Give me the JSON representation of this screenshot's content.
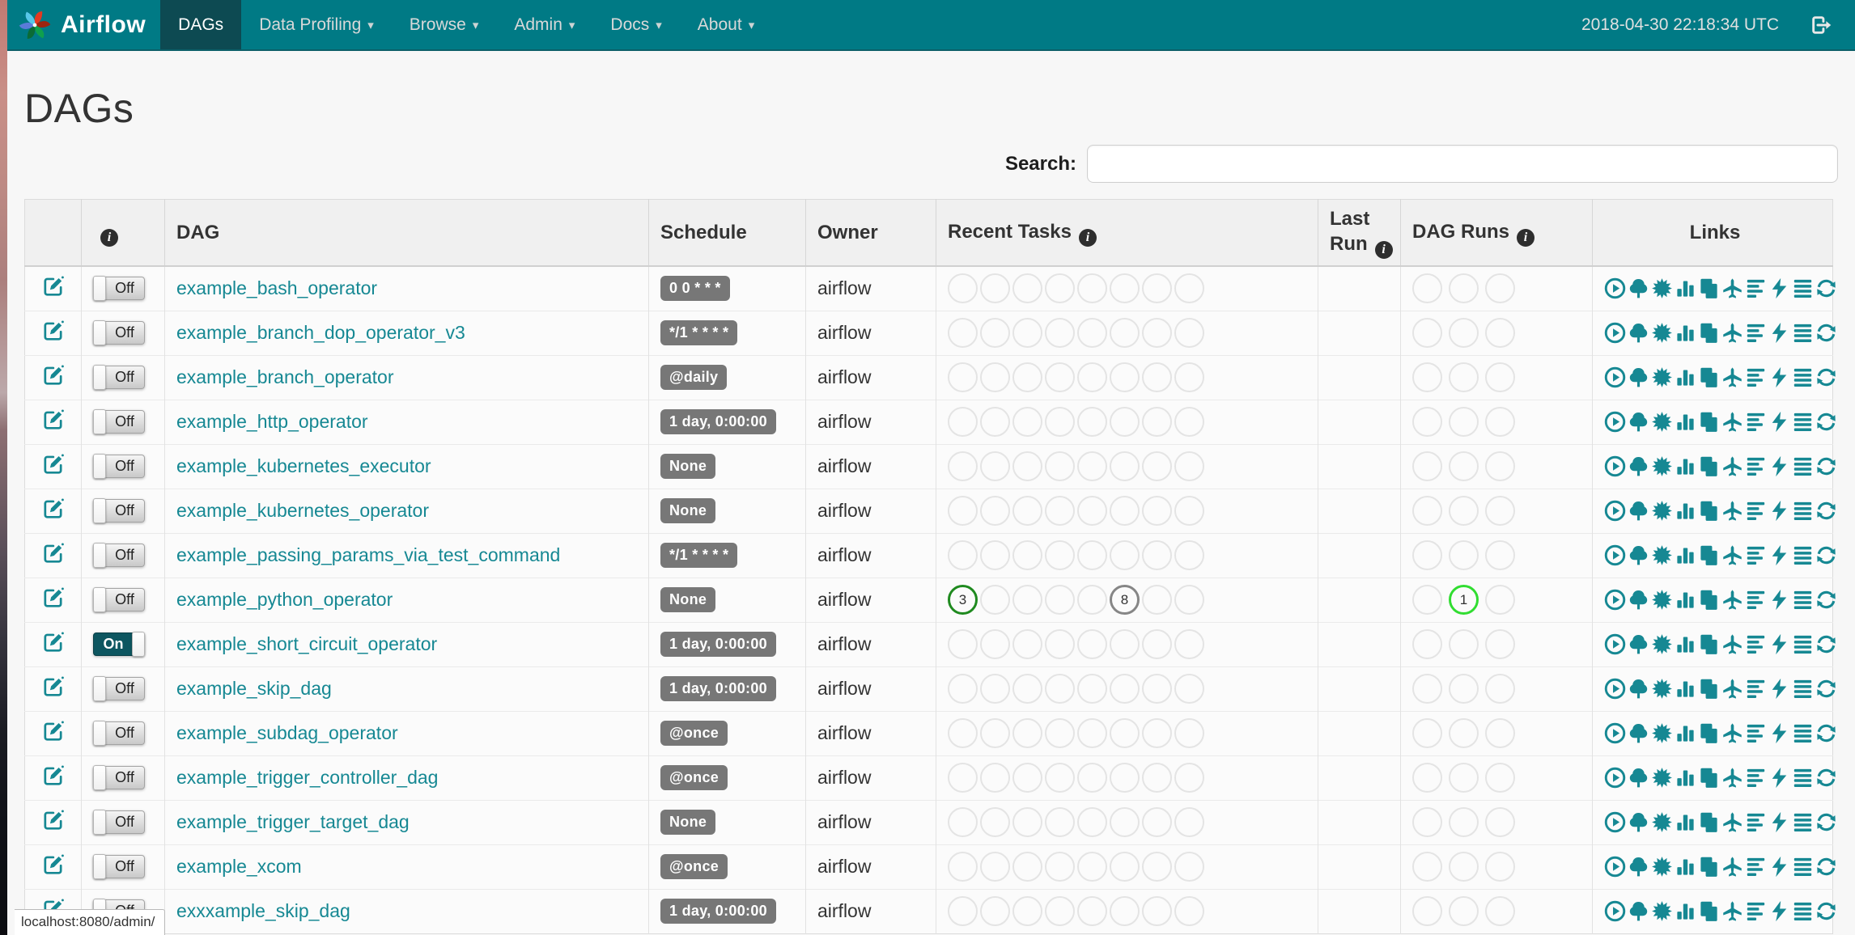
{
  "navbar": {
    "brand": "Airflow",
    "items": [
      {
        "label": "DAGs",
        "active": true,
        "caret": false
      },
      {
        "label": "Data Profiling",
        "active": false,
        "caret": true
      },
      {
        "label": "Browse",
        "active": false,
        "caret": true
      },
      {
        "label": "Admin",
        "active": false,
        "caret": true
      },
      {
        "label": "Docs",
        "active": false,
        "caret": true
      },
      {
        "label": "About",
        "active": false,
        "caret": true
      }
    ],
    "clock": "2018-04-30 22:18:34 UTC"
  },
  "page": {
    "title": "DAGs",
    "search_label": "Search:",
    "search_value": "",
    "status_tooltip": "localhost:8080/admin/"
  },
  "table": {
    "headers": [
      {
        "label": "",
        "info": false
      },
      {
        "label": "",
        "info": true
      },
      {
        "label": "DAG",
        "info": false
      },
      {
        "label": "Schedule",
        "info": false
      },
      {
        "label": "Owner",
        "info": false
      },
      {
        "label": "Recent Tasks",
        "info": true
      },
      {
        "label": "Last Run",
        "info": true
      },
      {
        "label": "DAG Runs",
        "info": true
      },
      {
        "label": "Links",
        "info": false,
        "center": true
      }
    ],
    "toggle_labels": {
      "on": "On",
      "off": "Off"
    },
    "recent_task_slots": 8,
    "dag_run_slots": 3,
    "state_colors": {
      "success": "#1f8a1f",
      "running": "#31dd31",
      "queued": "#868686",
      "empty": "#e4e4e4"
    },
    "links": [
      {
        "name": "trigger-dag",
        "icon": "play-circle"
      },
      {
        "name": "tree-view",
        "icon": "tree"
      },
      {
        "name": "graph-view",
        "icon": "certificate"
      },
      {
        "name": "task-duration",
        "icon": "bar-chart"
      },
      {
        "name": "task-tries",
        "icon": "duplicate"
      },
      {
        "name": "landing-times",
        "icon": "plane"
      },
      {
        "name": "gantt",
        "icon": "align-left"
      },
      {
        "name": "code-view",
        "icon": "flash"
      },
      {
        "name": "logs",
        "icon": "align-justify"
      },
      {
        "name": "refresh",
        "icon": "refresh"
      }
    ],
    "rows": [
      {
        "dag": "example_bash_operator",
        "enabled": false,
        "schedule": "0 0 * * *",
        "owner": "airflow",
        "last_run": "",
        "recent_tasks": {},
        "dag_runs": {}
      },
      {
        "dag": "example_branch_dop_operator_v3",
        "enabled": false,
        "schedule": "*/1 * * * *",
        "owner": "airflow",
        "last_run": "",
        "recent_tasks": {},
        "dag_runs": {}
      },
      {
        "dag": "example_branch_operator",
        "enabled": false,
        "schedule": "@daily",
        "owner": "airflow",
        "last_run": "",
        "recent_tasks": {},
        "dag_runs": {}
      },
      {
        "dag": "example_http_operator",
        "enabled": false,
        "schedule": "1 day, 0:00:00",
        "owner": "airflow",
        "last_run": "",
        "recent_tasks": {},
        "dag_runs": {}
      },
      {
        "dag": "example_kubernetes_executor",
        "enabled": false,
        "schedule": "None",
        "owner": "airflow",
        "last_run": "",
        "recent_tasks": {},
        "dag_runs": {}
      },
      {
        "dag": "example_kubernetes_operator",
        "enabled": false,
        "schedule": "None",
        "owner": "airflow",
        "last_run": "",
        "recent_tasks": {},
        "dag_runs": {}
      },
      {
        "dag": "example_passing_params_via_test_command",
        "enabled": false,
        "schedule": "*/1 * * * *",
        "owner": "airflow",
        "last_run": "",
        "recent_tasks": {},
        "dag_runs": {}
      },
      {
        "dag": "example_python_operator",
        "enabled": false,
        "schedule": "None",
        "owner": "airflow",
        "last_run": "",
        "recent_tasks": {
          "0": {
            "value": "3",
            "state": "success"
          },
          "5": {
            "value": "8",
            "state": "queued"
          }
        },
        "dag_runs": {
          "1": {
            "value": "1",
            "state": "running"
          }
        }
      },
      {
        "dag": "example_short_circuit_operator",
        "enabled": true,
        "schedule": "1 day, 0:00:00",
        "owner": "airflow",
        "last_run": "",
        "recent_tasks": {},
        "dag_runs": {}
      },
      {
        "dag": "example_skip_dag",
        "enabled": false,
        "schedule": "1 day, 0:00:00",
        "owner": "airflow",
        "last_run": "",
        "recent_tasks": {},
        "dag_runs": {}
      },
      {
        "dag": "example_subdag_operator",
        "enabled": false,
        "schedule": "@once",
        "owner": "airflow",
        "last_run": "",
        "recent_tasks": {},
        "dag_runs": {}
      },
      {
        "dag": "example_trigger_controller_dag",
        "enabled": false,
        "schedule": "@once",
        "owner": "airflow",
        "last_run": "",
        "recent_tasks": {},
        "dag_runs": {}
      },
      {
        "dag": "example_trigger_target_dag",
        "enabled": false,
        "schedule": "None",
        "owner": "airflow",
        "last_run": "",
        "recent_tasks": {},
        "dag_runs": {}
      },
      {
        "dag": "example_xcom",
        "enabled": false,
        "schedule": "@once",
        "owner": "airflow",
        "last_run": "",
        "recent_tasks": {},
        "dag_runs": {}
      },
      {
        "dag": "exxxample_skip_dag",
        "enabled": false,
        "schedule": "1 day, 0:00:00",
        "owner": "airflow",
        "last_run": "",
        "recent_tasks": {},
        "dag_runs": {}
      }
    ]
  }
}
